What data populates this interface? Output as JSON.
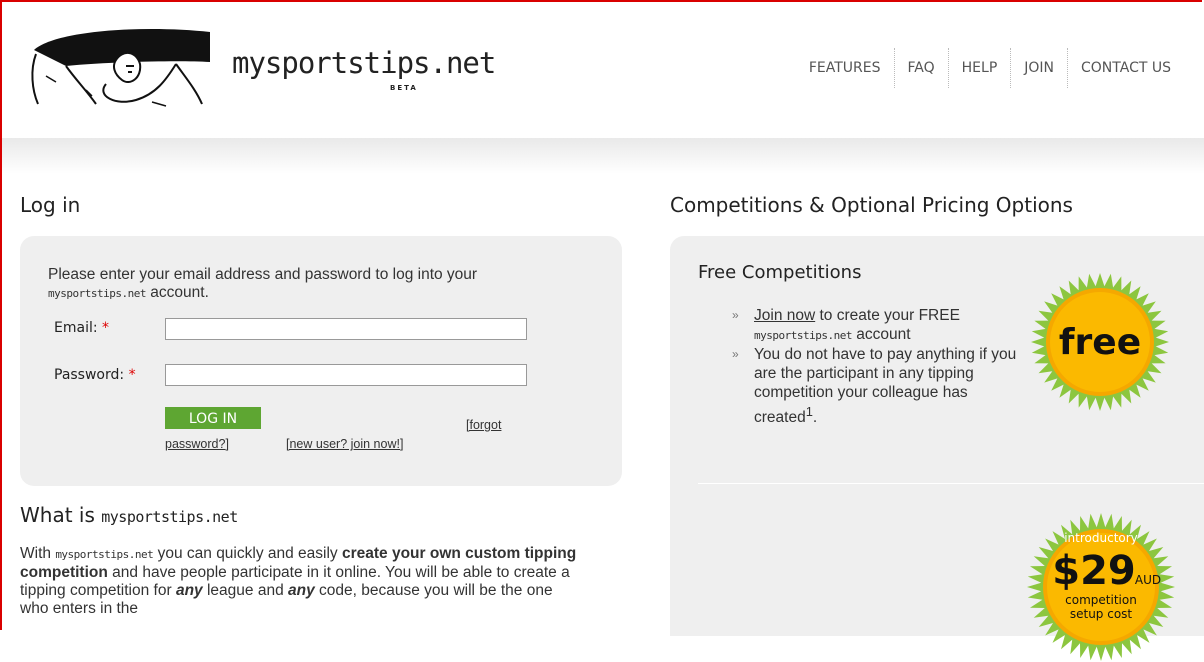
{
  "brand": {
    "name": "mysportstips.net",
    "beta": "BETA"
  },
  "nav": [
    "FEATURES",
    "FAQ",
    "HELP",
    "JOIN",
    "CONTACT US"
  ],
  "login": {
    "heading": "Log in",
    "intro_1": "Please enter your email address and password to log into your",
    "intro_brand": "mysportstips.net",
    "intro_2": "account.",
    "email_label": "Email:",
    "password_label": "Password:",
    "required": "*",
    "email_value": "",
    "password_value": "",
    "button": "LOG IN",
    "forgot_1": "[forgot",
    "forgot_2": "password?]",
    "new_user": "[new user? join now!]"
  },
  "about": {
    "heading_prefix": "What is",
    "heading_brand": "mysportstips.net",
    "p_a": "With",
    "p_brand": "mysportstips.net",
    "p_b": "you can quickly and easily",
    "p_bold": "create your own custom tipping competition",
    "p_c": "and have people participate in it online. You will be able to create a tipping competition for",
    "p_any1": "any",
    "p_d": "league and",
    "p_any2": "any",
    "p_e": "code, because you will be the one who enters in the"
  },
  "pricing": {
    "heading": "Competitions & Optional Pricing Options",
    "free_heading": "Free Competitions",
    "item1_link": "Join now",
    "item1_text": "to create your FREE",
    "item1_brand": "mysportstips.net",
    "item1_end": "account",
    "item2_text": "You do not have to pay anything if you are the participant in any tipping competition your colleague has created",
    "item2_sup": "1",
    "item2_end": ".",
    "bullet": "»",
    "free_badge": "free",
    "paid_badge_top": "introductory",
    "paid_badge_price": "$29",
    "paid_badge_unit": "AUD",
    "paid_badge_line1": "competition",
    "paid_badge_line2": "setup cost"
  },
  "colors": {
    "frame": "#d90000",
    "button": "#5ea632",
    "badge": "#f5a800",
    "badge_edge": "#8cc63f"
  }
}
